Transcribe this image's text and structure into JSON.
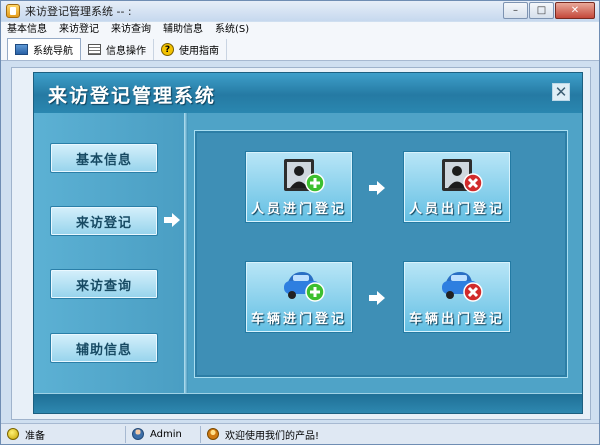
{
  "window": {
    "title": "来访登记管理系统 -- :",
    "buttons": {
      "minimize": "–",
      "maximize": "□",
      "close": "✕"
    }
  },
  "menu": [
    "基本信息",
    "来访登记",
    "来访查询",
    "辅助信息",
    "系统(S)"
  ],
  "tabs": [
    {
      "label": "系统导航",
      "icon": "nav-icon"
    },
    {
      "label": "信息操作",
      "icon": "info-icon"
    },
    {
      "label": "使用指南",
      "icon": "help-icon"
    }
  ],
  "panel": {
    "title": "来访登记管理系统",
    "close_glyph": "✕",
    "side_buttons": [
      "基本信息",
      "来访登记",
      "来访查询",
      "辅助信息"
    ],
    "actions": [
      {
        "label": "人员进门登记",
        "icon": "person-enter-icon"
      },
      {
        "label": "人员出门登记",
        "icon": "person-exit-icon"
      },
      {
        "label": "车辆进门登记",
        "icon": "car-enter-icon"
      },
      {
        "label": "车辆出门登记",
        "icon": "car-exit-icon"
      }
    ]
  },
  "status": {
    "state": "准备",
    "user": "Admin",
    "message": "欢迎使用我们的产品!"
  },
  "colors": {
    "panel_bg": "#2f84a8",
    "button_bg": "#96d3ec",
    "add_green": "#3cbf2f",
    "remove_red": "#d12b2b"
  }
}
